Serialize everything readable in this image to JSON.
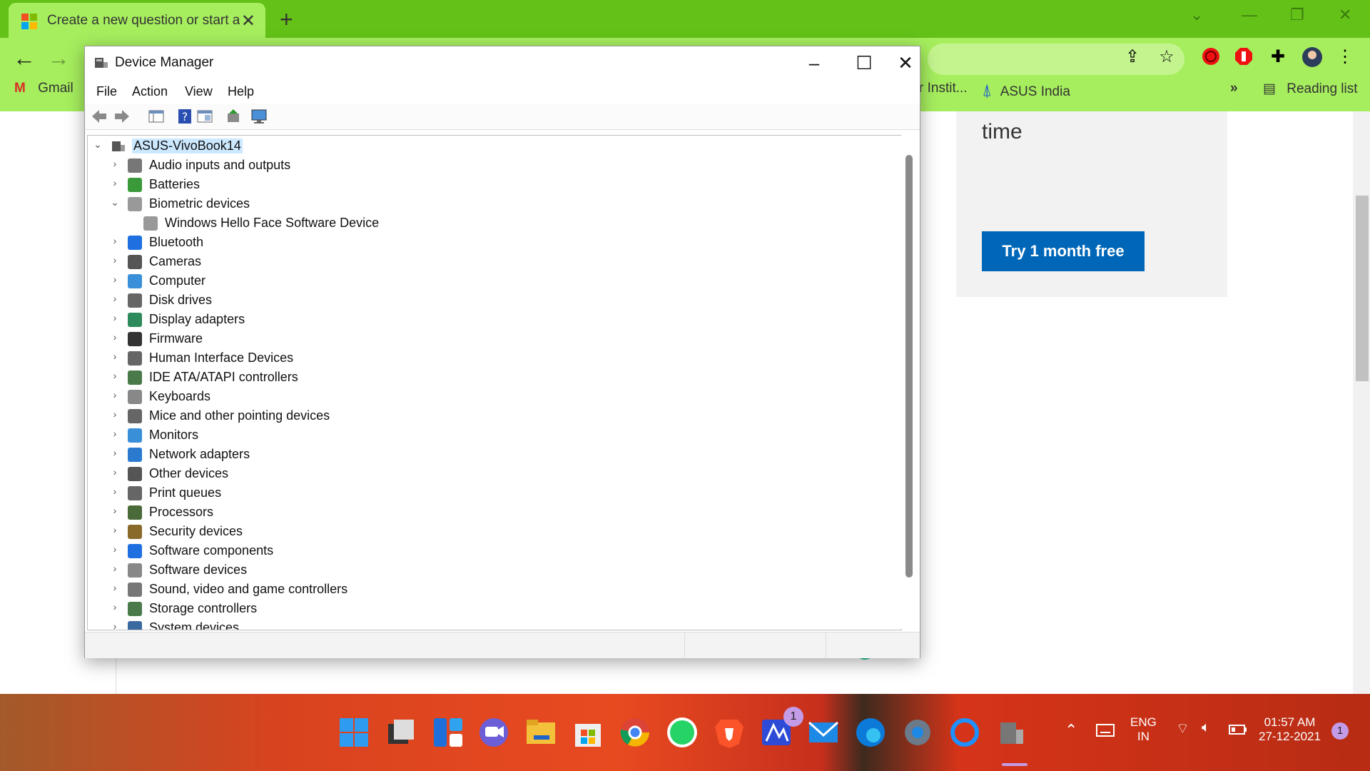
{
  "browser": {
    "tab_title": "Create a new question or start a",
    "bookmarks": {
      "gmail": "Gmail",
      "institute": "r Instit...",
      "asus": "ASUS India",
      "more": "»",
      "reading_list": "Reading list"
    }
  },
  "page": {
    "promo_text": "time",
    "cta_label": "Try 1 month free"
  },
  "device_manager": {
    "title": "Device Manager",
    "menu": [
      "File",
      "Action",
      "View",
      "Help"
    ],
    "root": "ASUS-VivoBook14",
    "items": [
      {
        "label": "Audio inputs and outputs",
        "icon": "speaker-icon",
        "expanded": false
      },
      {
        "label": "Batteries",
        "icon": "battery-icon",
        "expanded": false
      },
      {
        "label": "Biometric devices",
        "icon": "fingerprint-icon",
        "expanded": true
      },
      {
        "label": "Windows Hello Face Software Device",
        "icon": "fingerprint-icon",
        "child": true
      },
      {
        "label": "Bluetooth",
        "icon": "bluetooth-icon",
        "expanded": false
      },
      {
        "label": "Cameras",
        "icon": "camera-icon",
        "expanded": false
      },
      {
        "label": "Computer",
        "icon": "computer-icon",
        "expanded": false
      },
      {
        "label": "Disk drives",
        "icon": "disk-icon",
        "expanded": false
      },
      {
        "label": "Display adapters",
        "icon": "display-adapter-icon",
        "expanded": false
      },
      {
        "label": "Firmware",
        "icon": "chip-icon",
        "expanded": false
      },
      {
        "label": "Human Interface Devices",
        "icon": "hid-icon",
        "expanded": false
      },
      {
        "label": "IDE ATA/ATAPI controllers",
        "icon": "controller-icon",
        "expanded": false
      },
      {
        "label": "Keyboards",
        "icon": "keyboard-icon",
        "expanded": false
      },
      {
        "label": "Mice and other pointing devices",
        "icon": "mouse-icon",
        "expanded": false
      },
      {
        "label": "Monitors",
        "icon": "monitor-icon",
        "expanded": false
      },
      {
        "label": "Network adapters",
        "icon": "network-icon",
        "expanded": false
      },
      {
        "label": "Other devices",
        "icon": "unknown-device-icon",
        "expanded": false
      },
      {
        "label": "Print queues",
        "icon": "printer-icon",
        "expanded": false
      },
      {
        "label": "Processors",
        "icon": "processor-icon",
        "expanded": false
      },
      {
        "label": "Security devices",
        "icon": "security-icon",
        "expanded": false
      },
      {
        "label": "Software components",
        "icon": "software-component-icon",
        "expanded": false
      },
      {
        "label": "Software devices",
        "icon": "software-device-icon",
        "expanded": false
      },
      {
        "label": "Sound, video and game controllers",
        "icon": "speaker-icon",
        "expanded": false
      },
      {
        "label": "Storage controllers",
        "icon": "storage-icon",
        "expanded": false
      },
      {
        "label": "System devices",
        "icon": "system-icon",
        "expanded": false
      }
    ]
  },
  "taskbar": {
    "language": "ENG",
    "region": "IN",
    "time": "01:57 AM",
    "date": "27-12-2021",
    "badge_count": "1",
    "notification_count": "1"
  },
  "colors": {
    "chrome_frame": "#63c117",
    "chrome_toolbar": "#a6ee5e",
    "cta": "#0067b8"
  }
}
